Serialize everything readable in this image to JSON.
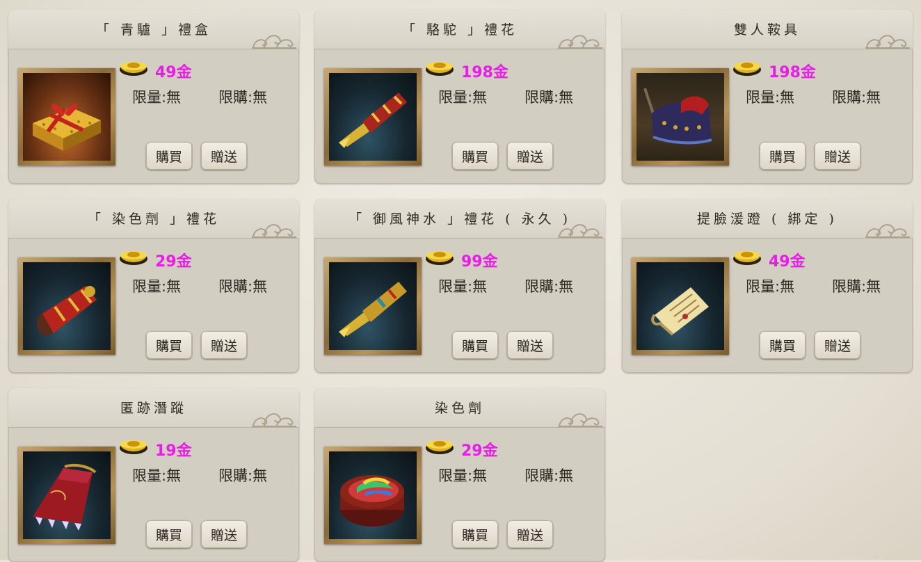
{
  "items": [
    {
      "name": "「 青驢 」禮盒",
      "price": "49金",
      "limit_qty": "限量:無",
      "limit_buy": "限購:無",
      "buy": "購買",
      "gift": "贈送",
      "icon": "gift-box-icon"
    },
    {
      "name": "「 駱駝 」禮花",
      "price": "198金",
      "limit_qty": "限量:無",
      "limit_buy": "限購:無",
      "buy": "購買",
      "gift": "贈送",
      "icon": "firework-scroll-icon"
    },
    {
      "name": "雙人鞍具",
      "price": "198金",
      "limit_qty": "限量:無",
      "limit_buy": "限購:無",
      "buy": "購買",
      "gift": "贈送",
      "icon": "saddle-icon"
    },
    {
      "name": "「 染色劑 」禮花",
      "price": "29金",
      "limit_qty": "限量:無",
      "limit_buy": "限購:無",
      "buy": "購買",
      "gift": "贈送",
      "icon": "firework-scroll-icon"
    },
    {
      "name": "「 御風神水 」禮花 ( 永久 )",
      "price": "99金",
      "limit_qty": "限量:無",
      "limit_buy": "限購:無",
      "buy": "購買",
      "gift": "贈送",
      "icon": "firework-scroll-icon"
    },
    {
      "name": "提臉湲蹬 ( 綁定 )",
      "price": "49金",
      "limit_qty": "限量:無",
      "limit_buy": "限購:無",
      "buy": "購買",
      "gift": "贈送",
      "icon": "scroll-paper-icon"
    },
    {
      "name": "匿跡潛蹤",
      "price": "19金",
      "limit_qty": "限量:無",
      "limit_buy": "限購:無",
      "buy": "購買",
      "gift": "贈送",
      "icon": "banner-icon"
    },
    {
      "name": "染色劑",
      "price": "29金",
      "limit_qty": "限量:無",
      "limit_buy": "限購:無",
      "buy": "購買",
      "gift": "贈送",
      "icon": "dye-jar-icon"
    }
  ],
  "colors": {
    "price": "#e81ee8",
    "panel": "#d3cec2",
    "text": "#2c2923"
  }
}
